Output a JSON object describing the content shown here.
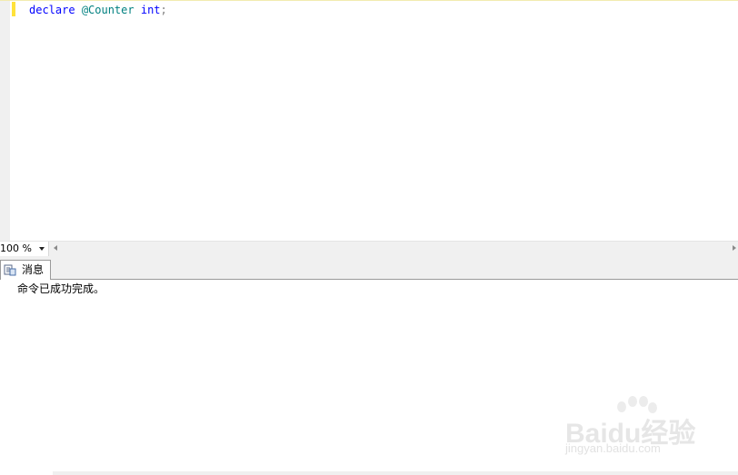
{
  "editor": {
    "code": {
      "keyword_declare": "declare",
      "variable": "@Counter",
      "type": "int",
      "terminator": ";"
    }
  },
  "status": {
    "zoom_value": "100 %"
  },
  "results": {
    "tab_label": "消息",
    "message_text": "命令已成功完成。"
  },
  "watermark": {
    "logo_text": "Baidu经验",
    "url_text": "jingyan.baidu.com"
  },
  "colors": {
    "keyword": "#0000ff",
    "variable": "#008080",
    "change_marker": "#ffe23a"
  },
  "icons": {
    "tab_icon": "messages-icon",
    "zoom_dropdown": "chevron-down-icon",
    "scroll_left": "scroll-left-arrow-icon",
    "scroll_right": "scroll-right-arrow-icon"
  }
}
